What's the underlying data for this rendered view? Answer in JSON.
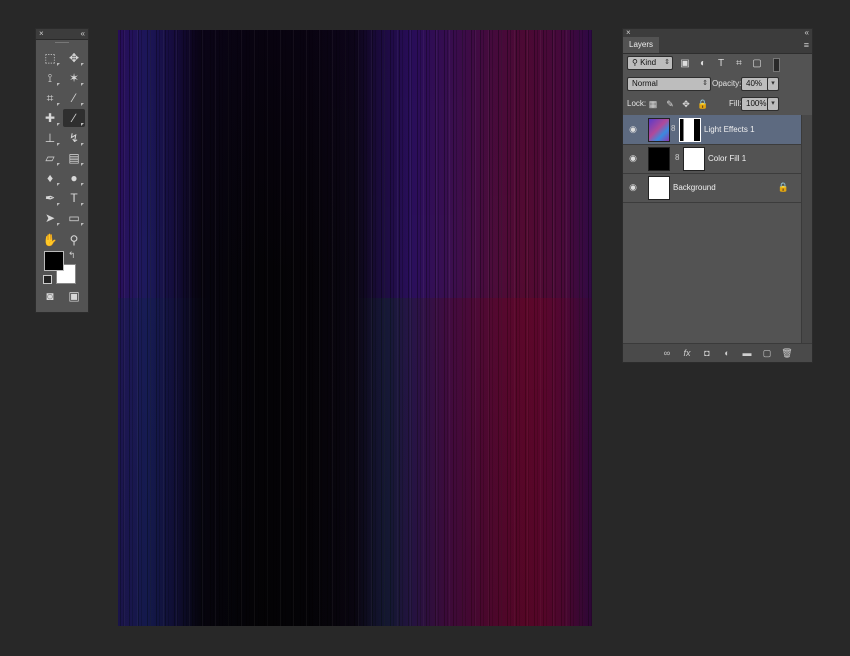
{
  "tools": {
    "close_glyph": "×",
    "collapse_glyph": "«",
    "items": [
      {
        "name": "rectangular-marquee-tool",
        "icon": "marquee-icon",
        "glyph": "⬚"
      },
      {
        "name": "move-tool",
        "icon": "move-icon",
        "glyph": "✥"
      },
      {
        "name": "polygonal-lasso-tool",
        "icon": "lasso-icon",
        "glyph": "⟟"
      },
      {
        "name": "magic-wand-tool",
        "icon": "magic-wand-icon",
        "glyph": "✶"
      },
      {
        "name": "crop-tool",
        "icon": "crop-icon",
        "glyph": "⌗"
      },
      {
        "name": "eyedropper-tool",
        "icon": "eyedropper-icon",
        "glyph": "⁄"
      },
      {
        "name": "spot-healing-tool",
        "icon": "bandage-icon",
        "glyph": "✚"
      },
      {
        "name": "brush-tool",
        "icon": "brush-icon",
        "glyph": "∕"
      },
      {
        "name": "clone-stamp-tool",
        "icon": "stamp-icon",
        "glyph": "⊥"
      },
      {
        "name": "history-brush-tool",
        "icon": "history-brush-icon",
        "glyph": "↯"
      },
      {
        "name": "eraser-tool",
        "icon": "eraser-icon",
        "glyph": "▱"
      },
      {
        "name": "gradient-tool",
        "icon": "gradient-icon",
        "glyph": "▤"
      },
      {
        "name": "blur-tool",
        "icon": "blur-icon",
        "glyph": "♦"
      },
      {
        "name": "dodge-tool",
        "icon": "dodge-icon",
        "glyph": "●"
      },
      {
        "name": "pen-tool",
        "icon": "pen-icon",
        "glyph": "✒"
      },
      {
        "name": "type-tool",
        "icon": "type-icon",
        "glyph": "T"
      },
      {
        "name": "path-selection-tool",
        "icon": "arrow-icon",
        "glyph": "➤"
      },
      {
        "name": "rectangle-tool",
        "icon": "rectangle-icon",
        "glyph": "▭"
      },
      {
        "name": "hand-tool",
        "icon": "hand-icon",
        "glyph": "✋"
      },
      {
        "name": "zoom-tool",
        "icon": "zoom-icon",
        "glyph": "⚲"
      },
      {
        "name": "quick-mask-button",
        "icon": "quick-mask-icon",
        "glyph": "◙"
      },
      {
        "name": "screen-mode-button",
        "icon": "screen-mode-icon",
        "glyph": "▣"
      }
    ],
    "foreground_color": "#000000",
    "background_color": "#ffffff",
    "swap_glyph": "↰"
  },
  "layers_panel": {
    "close_glyph": "×",
    "collapse_glyph": "«",
    "tab_label": "Layers",
    "menu_glyph": "≡",
    "filter": {
      "kind_label": "Kind",
      "search_glyph": "⚲",
      "arrow": "⇕"
    },
    "filter_icons": [
      "▣",
      "◐",
      "T",
      "⌗",
      "▢"
    ],
    "blend_mode": "Normal",
    "opacity_label": "Opacity:",
    "opacity_value": "40%",
    "lock_label": "Lock:",
    "lock_icons": [
      "▦",
      "✎",
      "✥",
      "🔒"
    ],
    "fill_label": "Fill:",
    "fill_value": "100%",
    "stepper_glyph": "▾",
    "eye_glyph": "◉",
    "chain_glyph": "8",
    "layers": [
      {
        "name": "Light Effects 1",
        "selected": true
      },
      {
        "name": "Color Fill 1",
        "selected": false
      },
      {
        "name": "Background",
        "selected": false,
        "locked": true,
        "lock_glyph": "🔒"
      }
    ],
    "footer_icons": [
      {
        "name": "link-layers-icon",
        "glyph": "∞"
      },
      {
        "name": "layer-style-icon",
        "glyph": "fx"
      },
      {
        "name": "add-mask-icon",
        "glyph": "◘"
      },
      {
        "name": "adjustment-layer-icon",
        "glyph": "◐"
      },
      {
        "name": "new-group-icon",
        "glyph": "▬"
      },
      {
        "name": "new-layer-icon",
        "glyph": "▢"
      },
      {
        "name": "delete-layer-icon",
        "glyph": "🗑"
      }
    ]
  }
}
